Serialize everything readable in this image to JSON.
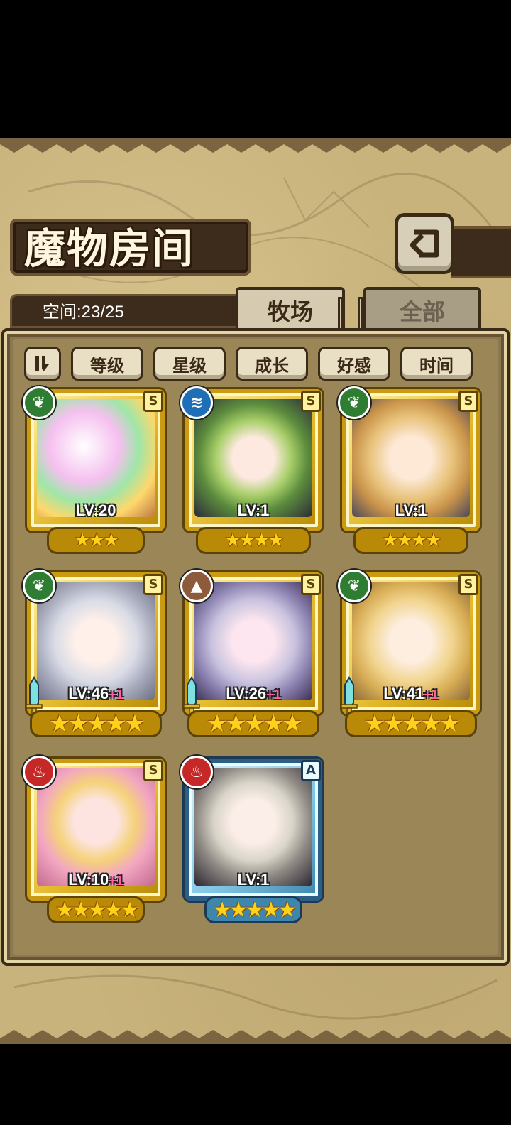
{
  "header": {
    "title": "魔物房间",
    "capacity_label": "空间:23/25"
  },
  "tabs": [
    {
      "label": "牧场",
      "active": true
    },
    {
      "label": "全部",
      "active": false
    }
  ],
  "sort": {
    "toggle_icon": "sort-order-icon",
    "options": [
      "等级",
      "星级",
      "成长",
      "好感",
      "时间"
    ]
  },
  "monsters": [
    {
      "element": "grass",
      "rank": "S",
      "level": "LV:20",
      "bonus": "",
      "stars": 3
    },
    {
      "element": "water",
      "rank": "S",
      "level": "LV:1",
      "bonus": "",
      "stars": 4
    },
    {
      "element": "grass",
      "rank": "S",
      "level": "LV:1",
      "bonus": "",
      "stars": 4
    },
    {
      "element": "grass",
      "rank": "S",
      "level": "LV:46",
      "bonus": "+1",
      "stars": 5
    },
    {
      "element": "earth",
      "rank": "S",
      "level": "LV:26",
      "bonus": "+1",
      "stars": 5
    },
    {
      "element": "grass",
      "rank": "S",
      "level": "LV:41",
      "bonus": "+1",
      "stars": 5
    },
    {
      "element": "fire",
      "rank": "S",
      "level": "LV:10",
      "bonus": "+1",
      "stars": 5
    },
    {
      "element": "fire",
      "rank": "A",
      "level": "LV:1",
      "bonus": "",
      "stars": 5
    }
  ],
  "colors": {
    "parchment": "#c9b37c",
    "gold_frame": "#e2b627",
    "blue_frame": "#7ec4e4",
    "dark_wood": "#3d2c1b"
  }
}
